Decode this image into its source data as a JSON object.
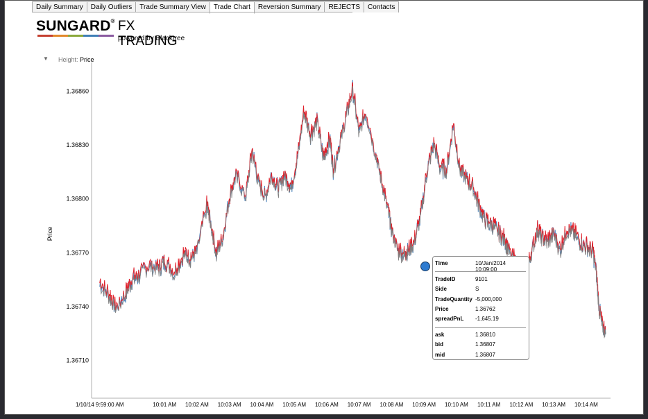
{
  "tabs": [
    "Daily Summary",
    "Daily Outliers",
    "Trade Summary View",
    "Trade Chart",
    "Reversion Summary",
    "REJECTS",
    "Contacts"
  ],
  "active_tab": "Trade Chart",
  "logo": {
    "brand": "SUNGARD",
    "product": "FX TRADING",
    "powered_by": "powered by Blacktree"
  },
  "control": {
    "height_label": "Height:",
    "height_value": "Price"
  },
  "colors": {
    "ask": "#e0202a",
    "bid": "#4b86c0",
    "mid": "#808080",
    "marker": "#2e7bd0"
  },
  "tooltip": {
    "time_label": "Time",
    "time_value": "10/Jan/2014 10:09:00",
    "fields": [
      {
        "label": "TradeID",
        "value": "9101"
      },
      {
        "label": "Side",
        "value": "S"
      },
      {
        "label": "TradeQuantity",
        "value": "-5,000,000"
      },
      {
        "label": "Price",
        "value": "1.36762"
      },
      {
        "label": "spreadPnL",
        "value": "-1,645.19"
      }
    ],
    "quotes": [
      {
        "label": "ask",
        "value": "1.36810"
      },
      {
        "label": "bid",
        "value": "1.36807"
      },
      {
        "label": "mid",
        "value": "1.36807"
      }
    ]
  },
  "chart_data": {
    "type": "line",
    "ylabel": "Price",
    "xlabel": "",
    "y_ticks": [
      "1.36860",
      "1.36830",
      "1.36800",
      "1.36770",
      "1.36740",
      "1.36710"
    ],
    "y_tick_values": [
      1.3686,
      1.3683,
      1.368,
      1.3677,
      1.3674,
      1.3671
    ],
    "ylim": [
      1.36689,
      1.36876
    ],
    "x_ticks": [
      "1/10/14 9:59:00 AM",
      "10:01 AM",
      "10:02 AM",
      "10:03 AM",
      "10:04 AM",
      "10:05 AM",
      "10:06 AM",
      "10:07 AM",
      "10:08 AM",
      "10:09 AM",
      "10:10 AM",
      "10:11 AM",
      "10:12 AM",
      "10:13 AM",
      "10:14 AM"
    ],
    "x_tick_minutes": [
      0,
      2,
      3,
      4,
      5,
      6,
      7,
      8,
      9,
      10,
      11,
      12,
      13,
      14,
      15
    ],
    "xlim_minutes": [
      -0.25,
      15.75
    ],
    "grid": false,
    "series": [
      {
        "x": [
          0.0,
          0.3,
          0.5,
          0.8,
          1.0,
          1.2,
          1.5,
          1.8,
          2.0,
          2.3,
          2.6,
          2.8,
          3.0,
          3.3,
          3.4,
          3.6,
          3.8,
          4.0,
          4.2,
          4.5,
          4.7,
          4.9,
          5.1,
          5.3,
          5.5,
          5.7,
          5.9,
          6.1,
          6.3,
          6.5,
          6.7,
          6.9,
          7.1,
          7.2,
          7.4,
          7.6,
          7.8,
          8.0,
          8.2,
          8.5,
          8.7,
          8.9,
          9.0,
          9.2,
          9.4,
          9.5,
          9.7,
          9.9,
          10.1,
          10.3,
          10.5,
          10.7,
          10.9,
          11.1,
          11.3,
          11.5,
          11.7,
          11.9,
          12.1,
          12.3,
          12.5,
          12.6,
          12.9,
          13.1,
          13.3,
          13.5,
          13.6,
          13.8,
          14.0,
          14.2,
          14.4,
          14.6,
          14.8,
          15.0,
          15.2,
          15.3,
          15.4,
          15.5,
          15.6
        ],
        "y": [
          1.36752,
          1.36745,
          1.36738,
          1.36746,
          1.36754,
          1.36756,
          1.36762,
          1.3676,
          1.36764,
          1.36758,
          1.36768,
          1.36766,
          1.3677,
          1.36795,
          1.36788,
          1.36768,
          1.36778,
          1.368,
          1.36812,
          1.368,
          1.36826,
          1.36808,
          1.368,
          1.36812,
          1.36805,
          1.36812,
          1.36805,
          1.36822,
          1.36848,
          1.36835,
          1.36842,
          1.36822,
          1.36832,
          1.36815,
          1.3683,
          1.36845,
          1.3686,
          1.36835,
          1.36848,
          1.36825,
          1.36808,
          1.36792,
          1.36782,
          1.3677,
          1.36768,
          1.3677,
          1.36775,
          1.3679,
          1.36815,
          1.3683,
          1.36816,
          1.36815,
          1.3684,
          1.36816,
          1.3681,
          1.36806,
          1.36795,
          1.36786,
          1.36785,
          1.3678,
          1.36776,
          1.3677,
          1.36762,
          1.36755,
          1.36768,
          1.36782,
          1.36778,
          1.36775,
          1.3678,
          1.3677,
          1.36782,
          1.3678,
          1.36775,
          1.36772,
          1.3677,
          1.3676,
          1.36738,
          1.36728,
          1.36725
        ]
      }
    ]
  }
}
